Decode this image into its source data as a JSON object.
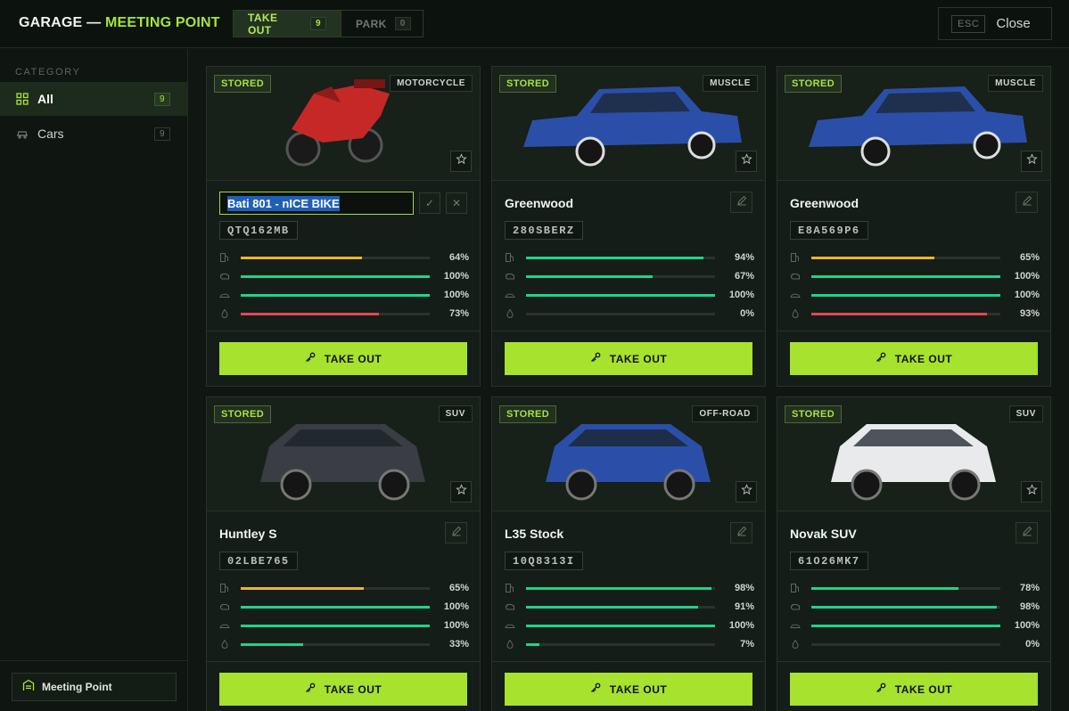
{
  "header": {
    "title_prefix": "GARAGE —",
    "title_location": "MEETING POINT",
    "tabs": [
      {
        "label": "TAKE OUT",
        "count": "9"
      },
      {
        "label": "PARK",
        "count": "0"
      }
    ],
    "esc_label": "ESC",
    "close_label": "Close"
  },
  "sidebar": {
    "heading": "CATEGORY",
    "items": [
      {
        "label": "All",
        "count": "9"
      },
      {
        "label": "Cars",
        "count": "9"
      }
    ],
    "location_label": "Meeting Point"
  },
  "colors": {
    "accent": "#a6e22e",
    "fuel": "#f0b429",
    "good": "#1fd38a",
    "bad": "#e2475d"
  },
  "vehicles": [
    {
      "status": "STORED",
      "type": "MOTORCYCLE",
      "name": "Bati 801 - nICE BIKE",
      "plate": "QTQ162MB",
      "editing": true,
      "stats": [
        "64%",
        "100%",
        "100%",
        "73%"
      ],
      "fills": [
        0.64,
        1.0,
        1.0,
        0.73
      ],
      "kinds": [
        "fuel",
        "good",
        "good",
        "bad"
      ],
      "action": "TAKE OUT"
    },
    {
      "status": "STORED",
      "type": "MUSCLE",
      "name": "Greenwood",
      "plate": "280SBERZ",
      "stats": [
        "94%",
        "67%",
        "100%",
        "0%"
      ],
      "fills": [
        0.94,
        0.67,
        1.0,
        0.0
      ],
      "kinds": [
        "good",
        "good",
        "good",
        "good"
      ],
      "action": "TAKE OUT"
    },
    {
      "status": "STORED",
      "type": "MUSCLE",
      "name": "Greenwood",
      "plate": "E8A569P6",
      "stats": [
        "65%",
        "100%",
        "100%",
        "93%"
      ],
      "fills": [
        0.65,
        1.0,
        1.0,
        0.93
      ],
      "kinds": [
        "fuel",
        "good",
        "good",
        "bad"
      ],
      "action": "TAKE OUT"
    },
    {
      "status": "STORED",
      "type": "SUV",
      "name": "Huntley S",
      "plate": "02LBE765",
      "stats": [
        "65%",
        "100%",
        "100%",
        "33%"
      ],
      "fills": [
        0.65,
        1.0,
        1.0,
        0.33
      ],
      "kinds": [
        "fuel",
        "good",
        "good",
        "good"
      ],
      "action": "TAKE OUT"
    },
    {
      "status": "STORED",
      "type": "OFF-ROAD",
      "name": "L35 Stock",
      "plate": "10Q8313I",
      "stats": [
        "98%",
        "91%",
        "100%",
        "7%"
      ],
      "fills": [
        0.98,
        0.91,
        1.0,
        0.07
      ],
      "kinds": [
        "good",
        "good",
        "good",
        "good"
      ],
      "action": "TAKE OUT"
    },
    {
      "status": "STORED",
      "type": "SUV",
      "name": "Novak SUV",
      "plate": "61O26MK7",
      "stats": [
        "78%",
        "98%",
        "100%",
        "0%"
      ],
      "fills": [
        0.78,
        0.98,
        1.0,
        0.0
      ],
      "kinds": [
        "good",
        "good",
        "good",
        "good"
      ],
      "action": "TAKE OUT"
    }
  ]
}
